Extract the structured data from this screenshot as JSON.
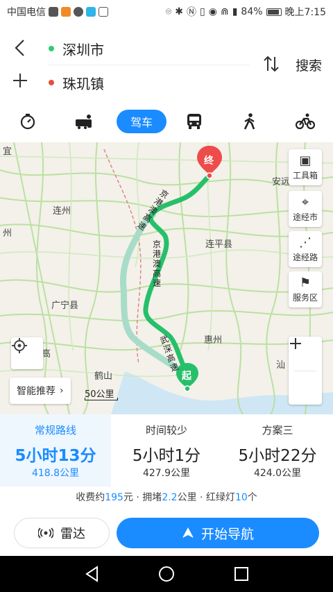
{
  "status_bar": {
    "carrier": "中国电信",
    "battery": "84%",
    "time": "晚上7:15"
  },
  "route": {
    "start": "深圳市",
    "end": "珠玑镇",
    "search_label": "搜索",
    "start_dot_color": "#2ecc71",
    "end_dot_color": "#e74c3c"
  },
  "modes": {
    "drive_label": "驾车",
    "icons": [
      "taxi-timer-icon",
      "carpool-icon",
      "drive",
      "bus-icon",
      "walk-icon",
      "bike-icon"
    ]
  },
  "map": {
    "labels": {
      "lianzhou": "连州",
      "lianping": "连平县",
      "guangning": "广宁县",
      "huizhou": "惠州",
      "heshan": "鹤山",
      "shantou": "汕",
      "anyuan": "安远",
      "zhou_left": "州",
      "li_left": "宜",
      "gao_left": "高"
    },
    "road_labels": {
      "r1": "京港澳高速",
      "r2": "京港澳高速",
      "r3": "武深高速"
    },
    "markers": {
      "end_label": "终",
      "start_label": "起"
    },
    "tools": {
      "toolbox": "工具箱",
      "via_city": "途经市",
      "via_road": "途经路",
      "service": "服务区"
    },
    "smart_recommend": "智能推荐",
    "scale": "50公里"
  },
  "route_options": [
    {
      "name": "常规路线",
      "time": "5小时13分",
      "distance": "418.8公里",
      "active": true
    },
    {
      "name": "时间较少",
      "time": "5小时1分",
      "distance": "427.9公里",
      "active": false
    },
    {
      "name": "方案三",
      "time": "5小时22分",
      "distance": "424.0公里",
      "active": false
    }
  ],
  "summary": {
    "toll_prefix": "收费约",
    "toll_value": "195",
    "toll_unit": "元 · 拥堵",
    "jam_value": "2.2",
    "jam_unit": "公里 · 红绿灯",
    "lights_value": "10",
    "lights_unit": "个"
  },
  "actions": {
    "radar": "雷达",
    "navigate": "开始导航"
  },
  "colors": {
    "accent": "#1a8cff",
    "route_main": "#27c06a",
    "route_alt": "#a8dcc8"
  }
}
